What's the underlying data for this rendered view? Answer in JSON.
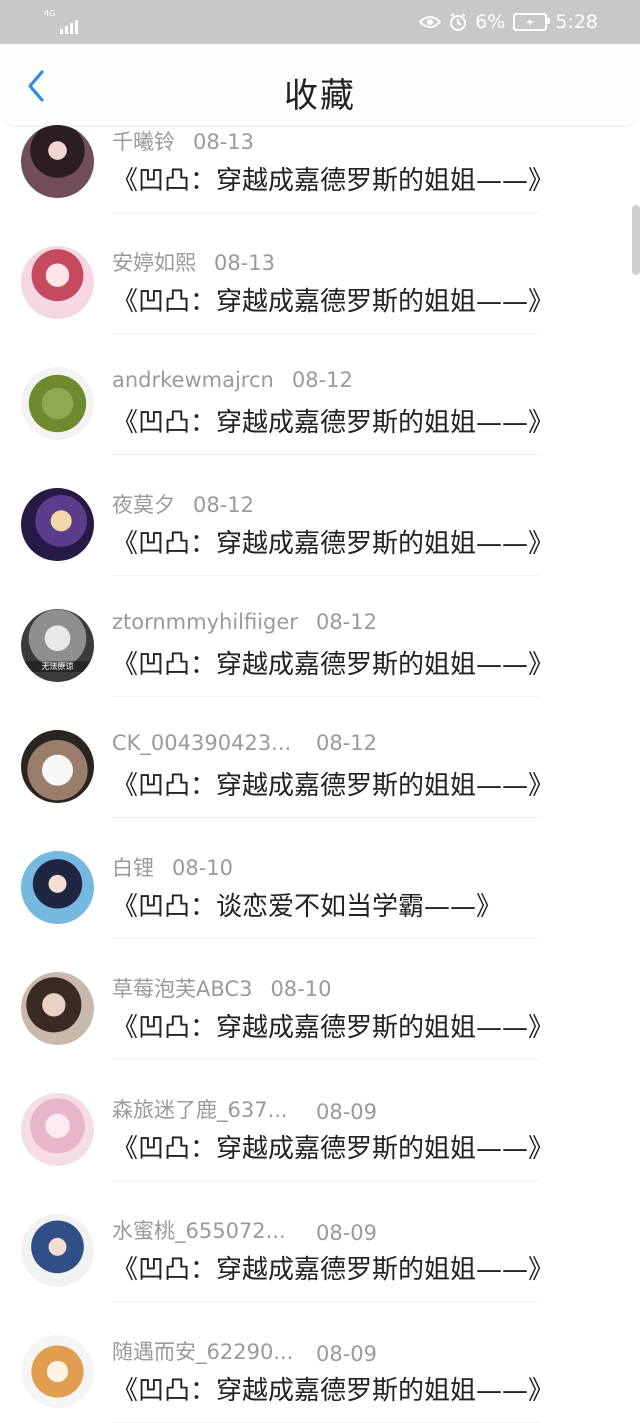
{
  "status_bar": {
    "network": "4G",
    "battery": "6%",
    "time": "5:28"
  },
  "header": {
    "title": "收藏"
  },
  "favorites": [
    {
      "name": "千曦铃",
      "date": "08-13",
      "book": "《凹凸：穿越成嘉德罗斯的姐姐——》"
    },
    {
      "name": "安婷如熙",
      "date": "08-13",
      "book": "《凹凸：穿越成嘉德罗斯的姐姐——》"
    },
    {
      "name": "andrkewmajrcn",
      "date": "08-12",
      "book": "《凹凸：穿越成嘉德罗斯的姐姐——》"
    },
    {
      "name": "夜莫夕",
      "date": "08-12",
      "book": "《凹凸：穿越成嘉德罗斯的姐姐——》"
    },
    {
      "name": "ztornmmyhilfiiger",
      "date": "08-12",
      "book": "《凹凸：穿越成嘉德罗斯的姐姐——》",
      "avatar_text": "无法原谅"
    },
    {
      "name": "CK_004390423...",
      "date": "08-12",
      "book": "《凹凸：穿越成嘉德罗斯的姐姐——》"
    },
    {
      "name": "白锂",
      "date": "08-10",
      "book": "《凹凸：谈恋爱不如当学霸——》"
    },
    {
      "name": "草莓泡芙ABC3",
      "date": "08-10",
      "book": "《凹凸：穿越成嘉德罗斯的姐姐——》"
    },
    {
      "name": "森旅迷了鹿_637...",
      "date": "08-09",
      "book": "《凹凸：穿越成嘉德罗斯的姐姐——》"
    },
    {
      "name": "水蜜桃_655072...",
      "date": "08-09",
      "book": "《凹凸：穿越成嘉德罗斯的姐姐——》"
    },
    {
      "name": "随遇而安_62290...",
      "date": "08-09",
      "book": "《凹凸：穿越成嘉德罗斯的姐姐——》"
    }
  ],
  "colors": {
    "accent": "#2e8be6",
    "status_bar": "#c8c8c8",
    "secondary_text": "#9a9a9a",
    "primary_text": "#222222"
  },
  "icons": {
    "back": "chevron-left-icon",
    "eye": "eye-icon",
    "alarm": "alarm-icon",
    "battery": "battery-icon",
    "signal": "signal-icon"
  }
}
